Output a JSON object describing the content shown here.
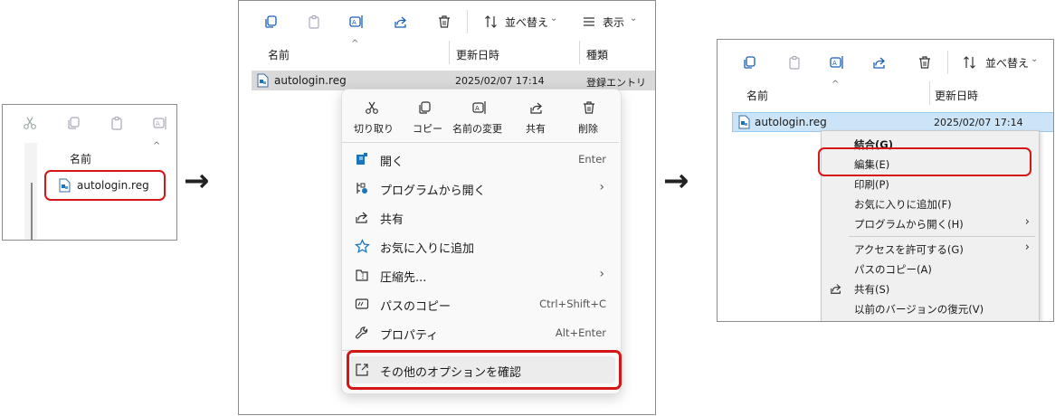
{
  "panel1": {
    "column_name": "名前",
    "file_name": "autologin.reg"
  },
  "panel2": {
    "toolbar": {
      "sort_label": "並べ替え",
      "view_label": "表示"
    },
    "columns": {
      "name": "名前",
      "date": "更新日時",
      "type": "種類"
    },
    "file": {
      "name": "autologin.reg",
      "date": "2025/02/07 17:14",
      "type": "登録エントリ"
    },
    "context_menu": {
      "quick_actions": [
        {
          "label": "切り取り",
          "icon": "cut-icon"
        },
        {
          "label": "コピー",
          "icon": "copy-icon"
        },
        {
          "label": "名前の変更",
          "icon": "rename-icon"
        },
        {
          "label": "共有",
          "icon": "share-icon"
        },
        {
          "label": "削除",
          "icon": "delete-icon"
        }
      ],
      "items": [
        {
          "label": "開く",
          "shortcut": "Enter",
          "icon": "open-icon"
        },
        {
          "label": "プログラムから開く",
          "shortcut": "",
          "icon": "open-with-icon",
          "submenu": true
        },
        {
          "label": "共有",
          "shortcut": "",
          "icon": "share-icon"
        },
        {
          "label": "お気に入りに追加",
          "shortcut": "",
          "icon": "star-icon"
        },
        {
          "label": "圧縮先...",
          "shortcut": "",
          "icon": "zip-icon",
          "submenu": true
        },
        {
          "label": "パスのコピー",
          "shortcut": "Ctrl+Shift+C",
          "icon": "copy-path-icon"
        },
        {
          "label": "プロパティ",
          "shortcut": "Alt+Enter",
          "icon": "wrench-icon"
        }
      ],
      "more_options": {
        "label": "その他のオプションを確認",
        "icon": "more-options-icon"
      }
    }
  },
  "panel3": {
    "toolbar": {
      "sort_label": "並べ替え"
    },
    "columns": {
      "name": "名前",
      "date": "更新日時"
    },
    "file": {
      "name": "autologin.reg",
      "date": "2025/02/07 17:14"
    },
    "classic_menu": [
      {
        "label": "結合(G)",
        "bold": true
      },
      {
        "label": "編集(E)"
      },
      {
        "label": "印刷(P)"
      },
      {
        "label": "お気に入りに追加(F)"
      },
      {
        "label": "プログラムから開く(H)",
        "submenu": true
      },
      {
        "label": "アクセスを許可する(G)",
        "submenu": true
      },
      {
        "label": "パスのコピー(A)"
      },
      {
        "label": "共有(S)",
        "icon": "share-icon"
      },
      {
        "label": "以前のバージョンの復元(V)"
      }
    ]
  },
  "arrows": [
    "→",
    "→"
  ],
  "colors": {
    "highlight": "#d41616",
    "selection": "#cce4f7",
    "accent": "#005fb8"
  }
}
